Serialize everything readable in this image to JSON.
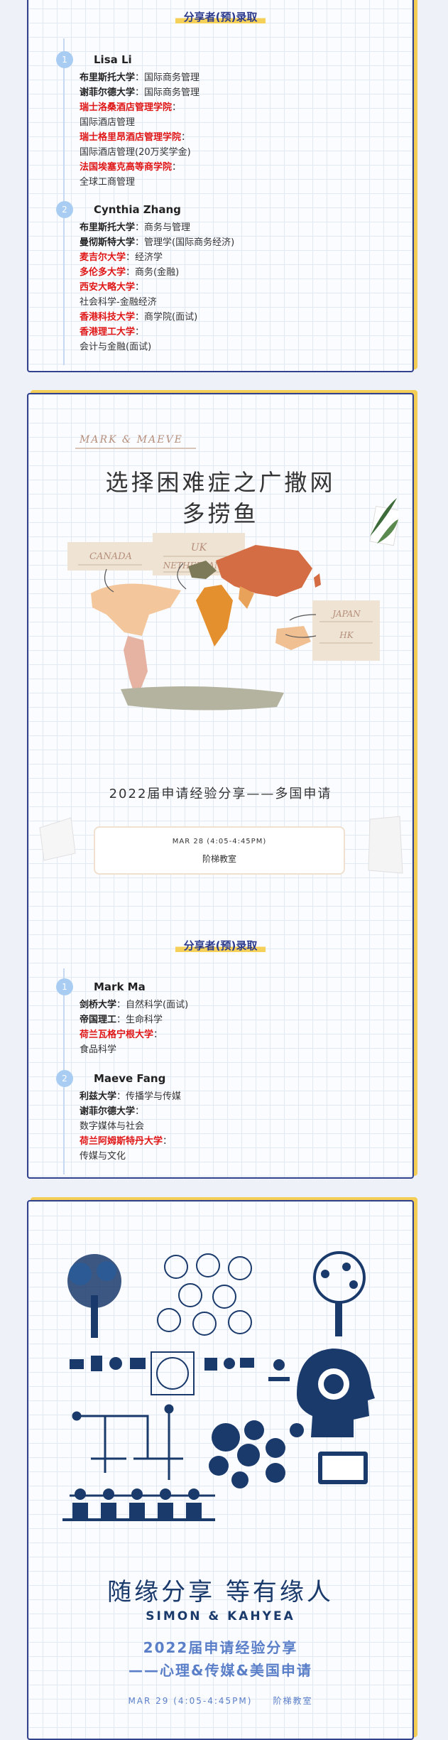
{
  "section_title": "分享者(预)录取",
  "card1": {
    "people": [
      {
        "number": "1",
        "name": "Lisa Li",
        "lines": [
          {
            "school": "布里斯托大学",
            "program": "国际商务管理",
            "highlight": false
          },
          {
            "school": "谢菲尔德大学",
            "program": "国际商务管理",
            "highlight": false
          },
          {
            "school": "瑞士洛桑酒店管理学院",
            "program": "国际酒店管理",
            "highlight": true
          },
          {
            "school": "瑞士格里昂酒店管理学院",
            "program": "国际酒店管理(20万奖学金)",
            "highlight": true
          },
          {
            "school": "法国埃塞克高等商学院",
            "program": "全球工商管理",
            "highlight": true
          }
        ]
      },
      {
        "number": "2",
        "name": "Cynthia Zhang",
        "lines": [
          {
            "school": "布里斯托大学",
            "program": "商务与管理",
            "highlight": false
          },
          {
            "school": "曼彻斯特大学",
            "program": "管理学(国际商务经济)",
            "highlight": false
          },
          {
            "school": "麦吉尔大学",
            "program": "经济学",
            "highlight": true
          },
          {
            "school": "多伦多大学",
            "program": "商务(金融)",
            "highlight": true
          },
          {
            "school": "西安大略大学",
            "program": "社会科学-金融经济",
            "highlight": true
          },
          {
            "school": "香港科技大学",
            "program": "商学院(面试)",
            "highlight": true
          },
          {
            "school": "香港理工大学",
            "program": "会计与金融(面试)",
            "highlight": true
          }
        ]
      }
    ]
  },
  "card2": {
    "brand": "MARK & MAEVE",
    "title_line1": "选择困难症之广撒网",
    "title_line2": "多捞鱼",
    "map_labels": {
      "canada": "CANADA",
      "uk": "UK",
      "netherlands": "NETHERLANDS",
      "japan": "JAPAN",
      "hk": "HK"
    },
    "event_subtitle": "2022届申请经验分享——多国申请",
    "event_date": "MAR 28 (4:05-4:45PM)",
    "event_place": "阶梯教室",
    "people": [
      {
        "number": "1",
        "name": "Mark Ma",
        "lines": [
          {
            "school": "剑桥大学",
            "program": "自然科学(面试)",
            "highlight": false
          },
          {
            "school": "帝国理工",
            "program": "生命科学",
            "highlight": false
          },
          {
            "school": "荷兰瓦格宁根大学",
            "program": "食品科学",
            "highlight": true
          }
        ]
      },
      {
        "number": "2",
        "name": "Maeve Fang",
        "lines": [
          {
            "school": "利兹大学",
            "program": "传播学与传媒",
            "highlight": false
          },
          {
            "school": "谢菲尔德大学",
            "program": "数字媒体与社会",
            "highlight": false
          },
          {
            "school": "荷兰阿姆斯特丹大学",
            "program": "传媒与文化",
            "highlight": true
          }
        ]
      }
    ]
  },
  "card3": {
    "slogan": "随缘分享  等有缘人",
    "names": "SIMON & KAHYEA",
    "event_line1": "2022届申请经验分享",
    "event_line2": "——心理&传媒&美国申请",
    "event_date": "MAR 29 (4:05-4:45PM)",
    "event_place": "阶梯教室"
  },
  "colors": {
    "navy": "#2b3a8c",
    "accent_yellow": "#f6d15a",
    "highlight_red": "#e01616",
    "timeline_blue": "#a9cdf2",
    "poster_blue": "#1a3a6c"
  }
}
